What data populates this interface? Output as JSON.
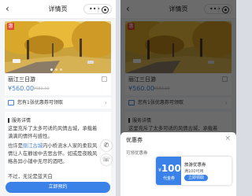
{
  "navbar": {
    "title": "详情页",
    "back_icon": "chevron-left-icon",
    "more_icon": "ellipsis-icon",
    "close_icon": "target-circle-icon"
  },
  "product": {
    "name": "丽江三日游",
    "price": "¥560.00",
    "original_price": "¥680.00",
    "badge_icon": "hot-tag-icon",
    "share_icon": "share-icon"
  },
  "coupon_row": {
    "text": "您有1张优惠券可领取",
    "icon": "coupon-icon",
    "arrow_icon": "chevron-right-icon"
  },
  "details": {
    "heading": "服务详情",
    "p1": "这里充斥了太多可诱的风情古城，承载着满满的情怀与感性。",
    "p2_pre": "也许是",
    "p2_highlight": "丽江古城",
    "p2_post": "内小桥流水人家的柔软风情让人在静谧中去思古怀。如或是夜晚风格各异小铺中无尽的酒吧。",
    "p3": "不过，无论是蓝天白"
  },
  "fab": {
    "top_icon": "phone-icon",
    "bottom_icon": "headset-icon"
  },
  "cta_label": "立即预约",
  "coupon_sheet": {
    "title": "优惠券",
    "subtitle": "可领优惠券",
    "close_icon": "close-icon",
    "coupon": {
      "currency": "¥",
      "amount": "100",
      "unit": "代金券",
      "name": "旅游优惠券",
      "condition": "满100可用",
      "button": "立即领取"
    }
  },
  "colors": {
    "accent": "#3b82e8",
    "price": "#4a84d8",
    "badge": "#e0483b"
  }
}
